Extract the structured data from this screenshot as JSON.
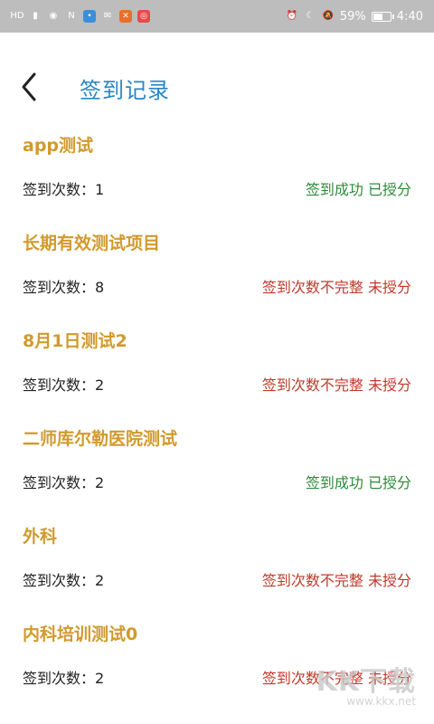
{
  "status_bar": {
    "left_icons": [
      "hd-icon",
      "signal-icon",
      "eye-icon",
      "nfc-icon",
      "app-blue-icon",
      "wechat-icon",
      "app-orange-icon",
      "app-red-icon"
    ],
    "battery_percent_text": "59%",
    "battery_level": 0.59,
    "time": "4:40",
    "right_icons": [
      "alarm-icon",
      "moon-icon",
      "mute-icon"
    ]
  },
  "header": {
    "back_icon": "chevron-left-icon",
    "title": "签到记录"
  },
  "colors": {
    "title": "#2a86c4",
    "record_name": "#d19a2d",
    "status_ok": "#2e8b3a",
    "status_bad": "#c0392b"
  },
  "records": [
    {
      "name": "app测试",
      "count_label": "签到次数：",
      "count": "1",
      "status": "签到成功 已授分",
      "ok": true
    },
    {
      "name": "长期有效测试项目",
      "count_label": "签到次数：",
      "count": "8",
      "status": "签到次数不完整 未授分",
      "ok": false
    },
    {
      "name": "8月1日测试2",
      "count_label": "签到次数：",
      "count": "2",
      "status": "签到次数不完整 未授分",
      "ok": false
    },
    {
      "name": "二师库尔勒医院测试",
      "count_label": "签到次数：",
      "count": "2",
      "status": "签到成功 已授分",
      "ok": true
    },
    {
      "name": "外科",
      "count_label": "签到次数：",
      "count": "2",
      "status": "签到次数不完整 未授分",
      "ok": false
    },
    {
      "name": "内科培训测试0",
      "count_label": "签到次数：",
      "count": "2",
      "status": "签到次数不完整 未授分",
      "ok": false
    }
  ],
  "watermark": {
    "main": "KK下载",
    "url": "www.kkx.net"
  }
}
